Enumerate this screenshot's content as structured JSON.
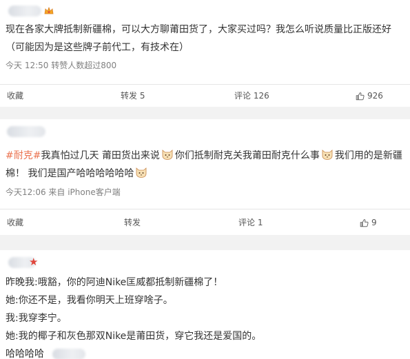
{
  "post1": {
    "text_line1": "现在各家大牌抵制新疆棉，可以大方聊莆田货了，大家买过吗？我怎么听说质量比正版还好",
    "text_line2": "（可能因为是这些牌子前代工，有技术在）",
    "meta": "今天 12:50 转赞人数超过800",
    "actions": {
      "collect": "收藏",
      "repost": "转发 5",
      "comment": "评论 126",
      "like": "926"
    }
  },
  "post2": {
    "hashtag": "#耐克#",
    "text_a": "我真怕过几天 莆田货出来说",
    "text_b": "你们抵制耐克关我莆田耐克什么事",
    "text_c": "我们用的是新疆",
    "text_d": "棉！ 我们是国产哈哈哈哈哈哈",
    "meta": "今天12:06  来自 iPhone客户端",
    "actions": {
      "collect": "收藏",
      "repost": "转发",
      "comment": "评论 1",
      "like": "9"
    }
  },
  "post3": {
    "lines": [
      "昨晚我:哦豁，你的阿迪Nike匡威都抵制新疆棉了！",
      "她:你还不是，我看你明天上班穿啥子。",
      "我:我穿李宁。",
      "她:我的椰子和灰色那双Nike是莆田货，穿它我还是爱国的。",
      "哈哈哈哈"
    ]
  },
  "icons": {
    "emoji": "cat-face-icon",
    "like": "thumbs-up-icon",
    "comment": "comment-bubble-icon",
    "badge": "crown-icon",
    "star": "star-icon"
  },
  "colors": {
    "hashtag": "#eb7350",
    "meta": "#808080",
    "separator": "#f2f2f2",
    "star": "#e0453b"
  }
}
